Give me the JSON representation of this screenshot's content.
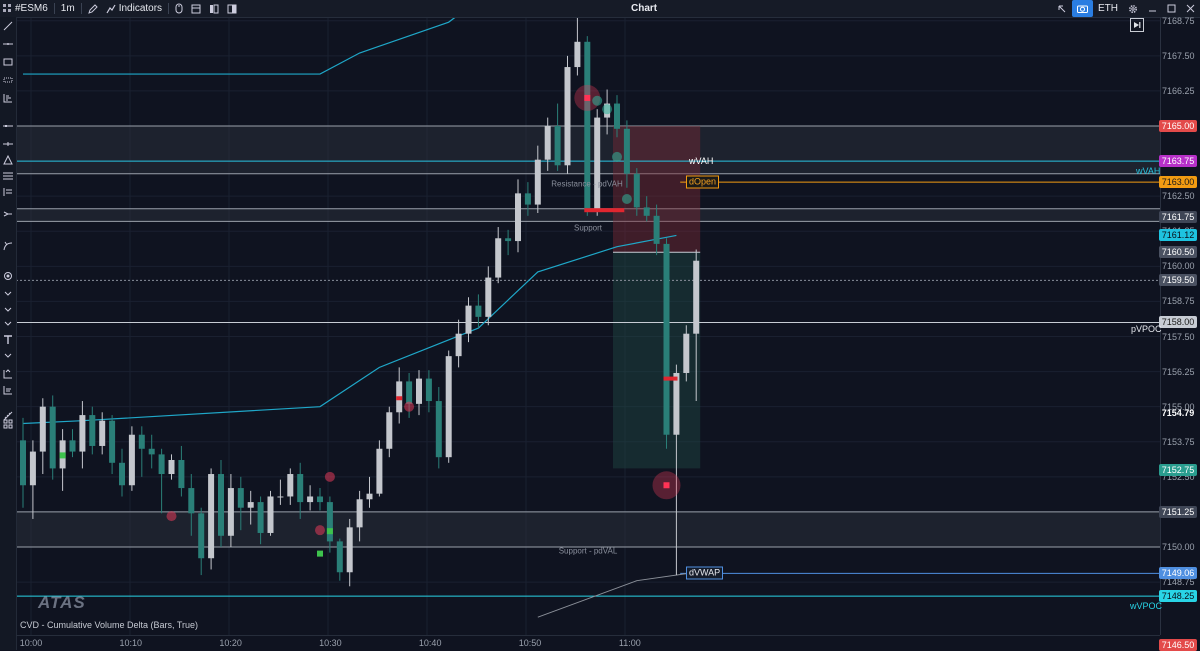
{
  "toolbar": {
    "symbol": "#ESM6",
    "timeframe": "1m",
    "indicators_label": "Indicators",
    "chart_title": "Chart",
    "session": "ETH"
  },
  "price_axis": {
    "ticks": [
      "7168.75",
      "7167.50",
      "7166.25",
      "7165.00",
      "7163.75",
      "7162.50",
      "7161.25",
      "7160.00",
      "7158.75",
      "7157.50",
      "7156.25",
      "7155.00",
      "7153.75",
      "7152.50",
      "7151.25",
      "7150.00",
      "7148.75"
    ],
    "labels": [
      {
        "text": "7165.00",
        "color": "#e34a4a",
        "fg": "#ffffff"
      },
      {
        "text": "7163.75",
        "color": "#b730c9",
        "fg": "#ffffff"
      },
      {
        "text": "7163.00",
        "color": "#f29b12",
        "fg": "#1a1a1a"
      },
      {
        "text": "7161.75",
        "color": "#3f4656",
        "fg": "#ffffff"
      },
      {
        "text": "7161.12",
        "color": "#1ec3e0",
        "fg": "#0a0f18"
      },
      {
        "text": "7160.50",
        "color": "#4a5161",
        "fg": "#ffffff"
      },
      {
        "text": "7159.50",
        "color": "#4a5161",
        "fg": "#ffffff"
      },
      {
        "text": "7158.00",
        "color": "#c7ccd4",
        "fg": "#1a1a1a"
      },
      {
        "text": "7154.79",
        "color": "transparent",
        "fg": "#ffffff"
      },
      {
        "text": "7152.75",
        "color": "#2a9d8f",
        "fg": "#ffffff"
      },
      {
        "text": "7151.25",
        "color": "#3f4656",
        "fg": "#ffffff"
      },
      {
        "text": "7149.06",
        "color": "#4f8fe0",
        "fg": "#ffffff"
      },
      {
        "text": "7148.25",
        "color": "#29d4e6",
        "fg": "#0a0f18"
      },
      {
        "text": "7146.50",
        "color": "#e34a4a",
        "fg": "#ffffff"
      }
    ]
  },
  "time_axis": [
    "10:00",
    "10:10",
    "10:20",
    "10:30",
    "10:40",
    "10:50",
    "11:00"
  ],
  "levels": {
    "wvah": "wVAH",
    "wvah_right": "wVAH",
    "dopen": "dOpen",
    "pvpoc": "pVPOC",
    "dvwap": "dVWAP",
    "wvpoc": "wVPOC",
    "resistance": "Resistance - pdVAH",
    "support": "Support",
    "support_pdval": "Support - pdVAL"
  },
  "indicator_label": "CVD - Cumulative Volume Delta (Bars, True)",
  "logo_text": "ATAS",
  "colors": {
    "background": "#0f1320",
    "bull": "#c4c7cd",
    "bear": "#2a7f78",
    "vwap": "#1fa7c8",
    "wvah": "#29c3e0",
    "dopen": "#f29b12",
    "zone": "#2a2f3a",
    "imbalance_red": "#e0262f",
    "imbalance_green": "#3ec34d"
  },
  "chart_data": {
    "type": "candlestick",
    "y_unit": "price",
    "yrange": [
      7146.5,
      7169.0
    ],
    "x_start": "10:00",
    "bar_interval": "1m",
    "candles": [
      [
        7153.8,
        7154.6,
        7151.4,
        7152.2
      ],
      [
        7152.2,
        7153.8,
        7151.0,
        7153.4
      ],
      [
        7153.4,
        7155.3,
        7152.6,
        7155.0
      ],
      [
        7155.0,
        7155.4,
        7152.4,
        7152.8
      ],
      [
        7152.8,
        7154.2,
        7152.0,
        7153.8
      ],
      [
        7153.8,
        7154.2,
        7153.2,
        7153.4
      ],
      [
        7153.4,
        7155.2,
        7152.8,
        7154.7
      ],
      [
        7154.7,
        7155.0,
        7153.3,
        7153.6
      ],
      [
        7153.6,
        7154.8,
        7153.3,
        7154.5
      ],
      [
        7154.5,
        7154.7,
        7152.6,
        7153.0
      ],
      [
        7153.0,
        7153.5,
        7151.8,
        7152.2
      ],
      [
        7152.2,
        7154.3,
        7152.0,
        7154.0
      ],
      [
        7154.0,
        7154.3,
        7152.5,
        7153.5
      ],
      [
        7153.5,
        7154.0,
        7152.8,
        7153.3
      ],
      [
        7153.3,
        7153.5,
        7151.2,
        7152.6
      ],
      [
        7152.6,
        7153.3,
        7152.4,
        7153.1
      ],
      [
        7153.1,
        7153.6,
        7151.8,
        7152.1
      ],
      [
        7152.1,
        7152.6,
        7150.4,
        7151.2
      ],
      [
        7151.2,
        7151.4,
        7149.0,
        7149.6
      ],
      [
        7149.6,
        7152.8,
        7149.2,
        7152.6
      ],
      [
        7152.6,
        7153.1,
        7150.0,
        7150.4
      ],
      [
        7150.4,
        7152.6,
        7150.0,
        7152.1
      ],
      [
        7152.1,
        7152.5,
        7150.6,
        7151.4
      ],
      [
        7151.4,
        7152.0,
        7150.8,
        7151.6
      ],
      [
        7151.6,
        7151.8,
        7150.1,
        7150.5
      ],
      [
        7150.5,
        7152.0,
        7150.4,
        7151.8
      ],
      [
        7151.8,
        7152.4,
        7151.5,
        7151.8
      ],
      [
        7151.8,
        7152.8,
        7151.5,
        7152.6
      ],
      [
        7152.6,
        7153.0,
        7151.0,
        7151.6
      ],
      [
        7151.6,
        7152.2,
        7151.3,
        7151.8
      ],
      [
        7151.8,
        7152.1,
        7151.3,
        7151.6
      ],
      [
        7151.6,
        7151.8,
        7149.8,
        7150.2
      ],
      [
        7150.2,
        7150.3,
        7148.8,
        7149.1
      ],
      [
        7149.1,
        7151.0,
        7148.6,
        7150.7
      ],
      [
        7150.7,
        7152.0,
        7150.2,
        7151.7
      ],
      [
        7151.7,
        7152.5,
        7151.4,
        7151.9
      ],
      [
        7151.9,
        7153.8,
        7151.8,
        7153.5
      ],
      [
        7153.5,
        7155.0,
        7153.2,
        7154.8
      ],
      [
        7154.8,
        7156.4,
        7154.4,
        7155.9
      ],
      [
        7155.9,
        7156.2,
        7154.6,
        7155.1
      ],
      [
        7155.1,
        7156.3,
        7154.7,
        7156.0
      ],
      [
        7156.0,
        7156.3,
        7154.8,
        7155.2
      ],
      [
        7155.2,
        7155.7,
        7152.8,
        7153.2
      ],
      [
        7153.2,
        7157.0,
        7153.0,
        7156.8
      ],
      [
        7156.8,
        7158.1,
        7156.4,
        7157.6
      ],
      [
        7157.6,
        7158.9,
        7157.3,
        7158.6
      ],
      [
        7158.6,
        7159.0,
        7157.8,
        7158.2
      ],
      [
        7158.2,
        7160.0,
        7157.9,
        7159.6
      ],
      [
        7159.6,
        7161.4,
        7159.4,
        7161.0
      ],
      [
        7161.0,
        7161.3,
        7160.4,
        7160.9
      ],
      [
        7160.9,
        7163.1,
        7160.5,
        7162.6
      ],
      [
        7162.6,
        7163.0,
        7161.8,
        7162.2
      ],
      [
        7162.2,
        7164.3,
        7161.9,
        7163.8
      ],
      [
        7163.8,
        7165.3,
        7163.4,
        7165.0
      ],
      [
        7165.0,
        7165.8,
        7163.4,
        7163.6
      ],
      [
        7163.6,
        7167.5,
        7163.3,
        7167.1
      ],
      [
        7167.1,
        7168.9,
        7166.8,
        7168.0
      ],
      [
        7168.0,
        7168.2,
        7161.8,
        7162.0
      ],
      [
        7162.0,
        7165.6,
        7161.8,
        7165.3
      ],
      [
        7165.3,
        7166.3,
        7164.7,
        7165.8
      ],
      [
        7165.8,
        7166.1,
        7164.6,
        7164.9
      ],
      [
        7164.9,
        7165.2,
        7162.8,
        7163.3
      ],
      [
        7163.3,
        7163.5,
        7161.8,
        7162.1
      ],
      [
        7162.1,
        7162.5,
        7161.6,
        7161.8
      ],
      [
        7161.8,
        7162.2,
        7160.4,
        7160.8
      ],
      [
        7160.8,
        7161.0,
        7153.5,
        7154.0
      ],
      [
        7154.0,
        7156.5,
        7149.0,
        7156.2
      ],
      [
        7156.2,
        7157.9,
        7155.9,
        7157.6
      ],
      [
        7157.6,
        7160.6,
        7155.2,
        7160.2
      ]
    ],
    "vwap_line": [
      [
        0,
        7155.5
      ],
      [
        10,
        7155.7
      ],
      [
        20,
        7155.8
      ],
      [
        30,
        7156.0
      ],
      [
        36,
        7158.2
      ],
      [
        43,
        7159.4
      ],
      [
        48,
        7164.2
      ],
      [
        51,
        7168.0
      ],
      [
        56,
        7168.8
      ],
      [
        63,
        7169.2
      ]
    ],
    "dvwap_line": [
      [
        52,
        7147.5
      ],
      [
        60,
        7148.9
      ],
      [
        69,
        7149.3
      ]
    ],
    "horizontal_levels": {
      "wvah": 7163.75,
      "dopen": 7163.0,
      "pvpoc": 7158.0,
      "dvwap": 7149.06,
      "wvpoc": 7148.25,
      "dotted": 7159.5
    },
    "zones": [
      {
        "label": "Resistance - pdVAH",
        "top": 7165.0,
        "bottom": 7163.3
      },
      {
        "label": "Support",
        "top": 7162.05,
        "bottom": 7161.6
      },
      {
        "label": "Support - pdVAL",
        "top": 7151.25,
        "bottom": 7150.0
      }
    ],
    "trade_box": {
      "top": 7165.0,
      "bottom": 7152.8,
      "stop": 7160.5
    },
    "signals": [
      {
        "idx": 57,
        "price": 7166.0
      },
      {
        "idx": 65,
        "price": 7152.2
      },
      {
        "idx": 15,
        "price": 7151.1
      },
      {
        "idx": 31,
        "price": 7152.5
      },
      {
        "idx": 30,
        "price": 7150.6
      },
      {
        "idx": 39,
        "price": 7155.0
      }
    ]
  }
}
